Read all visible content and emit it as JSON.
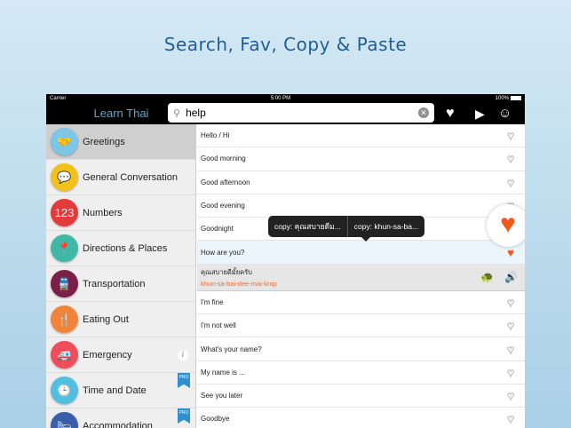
{
  "headline": "Search, Fav, Copy & Paste",
  "status": {
    "carrier": "Carrier",
    "time": "5:00 PM",
    "battery": "100%"
  },
  "nav": {
    "title": "Learn Thai",
    "search_value": "help"
  },
  "categories": [
    {
      "label": "Greetings",
      "color": "#7cc6e8",
      "glyph": "🤝"
    },
    {
      "label": "General Conversation",
      "color": "#f2c21b",
      "glyph": "💬"
    },
    {
      "label": "Numbers",
      "color": "#e23b3b",
      "glyph": "123"
    },
    {
      "label": "Directions & Places",
      "color": "#3fb8a8",
      "glyph": "📍"
    },
    {
      "label": "Transportation",
      "color": "#7a1f47",
      "glyph": "🚆"
    },
    {
      "label": "Eating Out",
      "color": "#f0843a",
      "glyph": "🍴"
    },
    {
      "label": "Emergency",
      "color": "#ef4d5c",
      "glyph": "🚑"
    },
    {
      "label": "Time and Date",
      "color": "#52bfe0",
      "glyph": "🕒"
    },
    {
      "label": "Accommodation",
      "color": "#3a5ea8",
      "glyph": "🛏"
    }
  ],
  "badges": {
    "info": "i",
    "pro": "PRO"
  },
  "phrases_top": [
    "Hello / Hi",
    "Good morning",
    "Good afternoon",
    "Good evening",
    "Goodnight"
  ],
  "selected_phrase": "How are you?",
  "expanded": {
    "thai": "คุณสบายดีมั้ยครับ",
    "romanized": "khun-sa-bai-dee-mai-krap"
  },
  "phrases_bottom": [
    "I'm fine",
    "I'm not well",
    "What's your name?",
    "My name is ...",
    "See you later",
    "Goodbye"
  ],
  "copy_menu": {
    "thai": "copy: คุณสบายดีม...",
    "romanized": "copy: khun-sa-ba..."
  }
}
